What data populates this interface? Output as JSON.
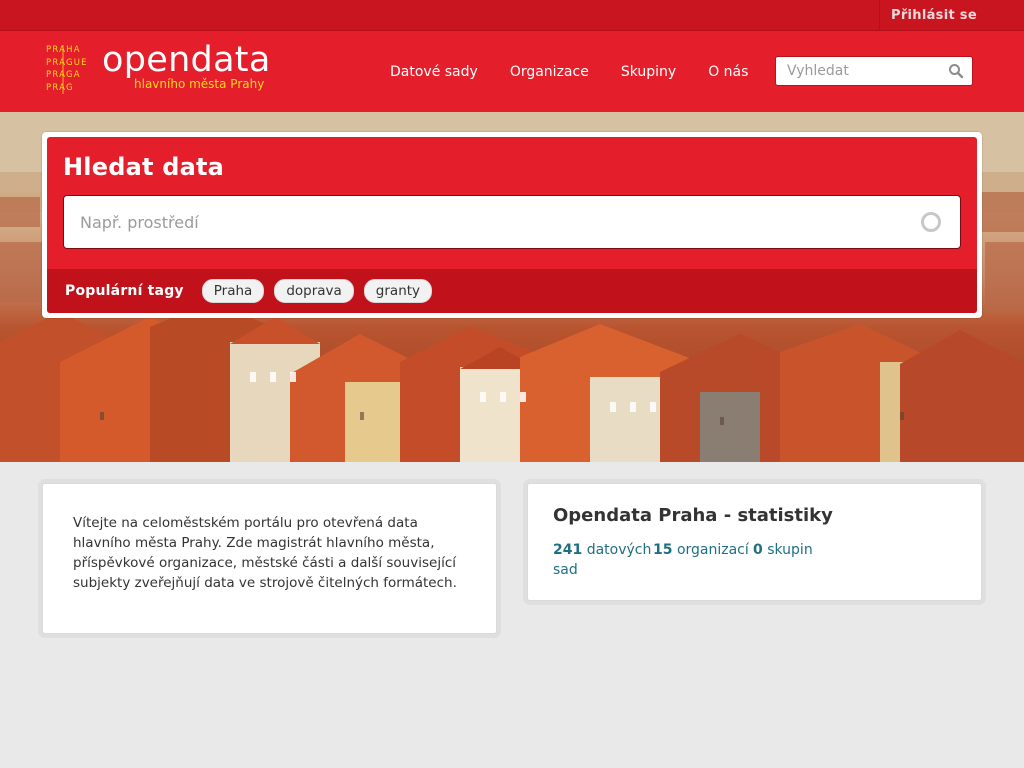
{
  "account": {
    "login_label": "Přihlásit se"
  },
  "header": {
    "logo_mark_lines": [
      "PRAHA",
      "PRAGUE",
      "PRAGA",
      "PRAG"
    ],
    "logo_title": "opendata",
    "logo_subtitle": "hlavního města Prahy",
    "nav": [
      {
        "label": "Datové sady"
      },
      {
        "label": "Organizace"
      },
      {
        "label": "Skupiny"
      },
      {
        "label": "O nás"
      }
    ],
    "search_placeholder": "Vyhledat",
    "search_icon": "search-icon"
  },
  "hero": {
    "heading": "Hledat data",
    "search_placeholder": "Např. prostředí",
    "search_icon": "search-icon",
    "tags_label": "Populární tagy",
    "tags": [
      "Praha",
      "doprava",
      "granty"
    ]
  },
  "welcome": {
    "text": "Vítejte na celoměstském portálu pro otevřená data hlavního města Prahy. Zde magistrát hlavního města, příspěvkové organizace, městské části a další související subjekty zveřejňují data ve strojově čitelných formátech."
  },
  "stats": {
    "title": "Opendata Praha - statistiky",
    "datasets": {
      "count": "241",
      "label": "datových sad"
    },
    "organizations": {
      "count": "15",
      "label": "organizací"
    },
    "groups": {
      "count": "0",
      "label": "skupin"
    }
  },
  "colors": {
    "brand_red": "#e41e2b",
    "brand_dark_red": "#c1121c",
    "logo_yellow": "#f7d81c",
    "stat_link": "#1f6f83"
  }
}
